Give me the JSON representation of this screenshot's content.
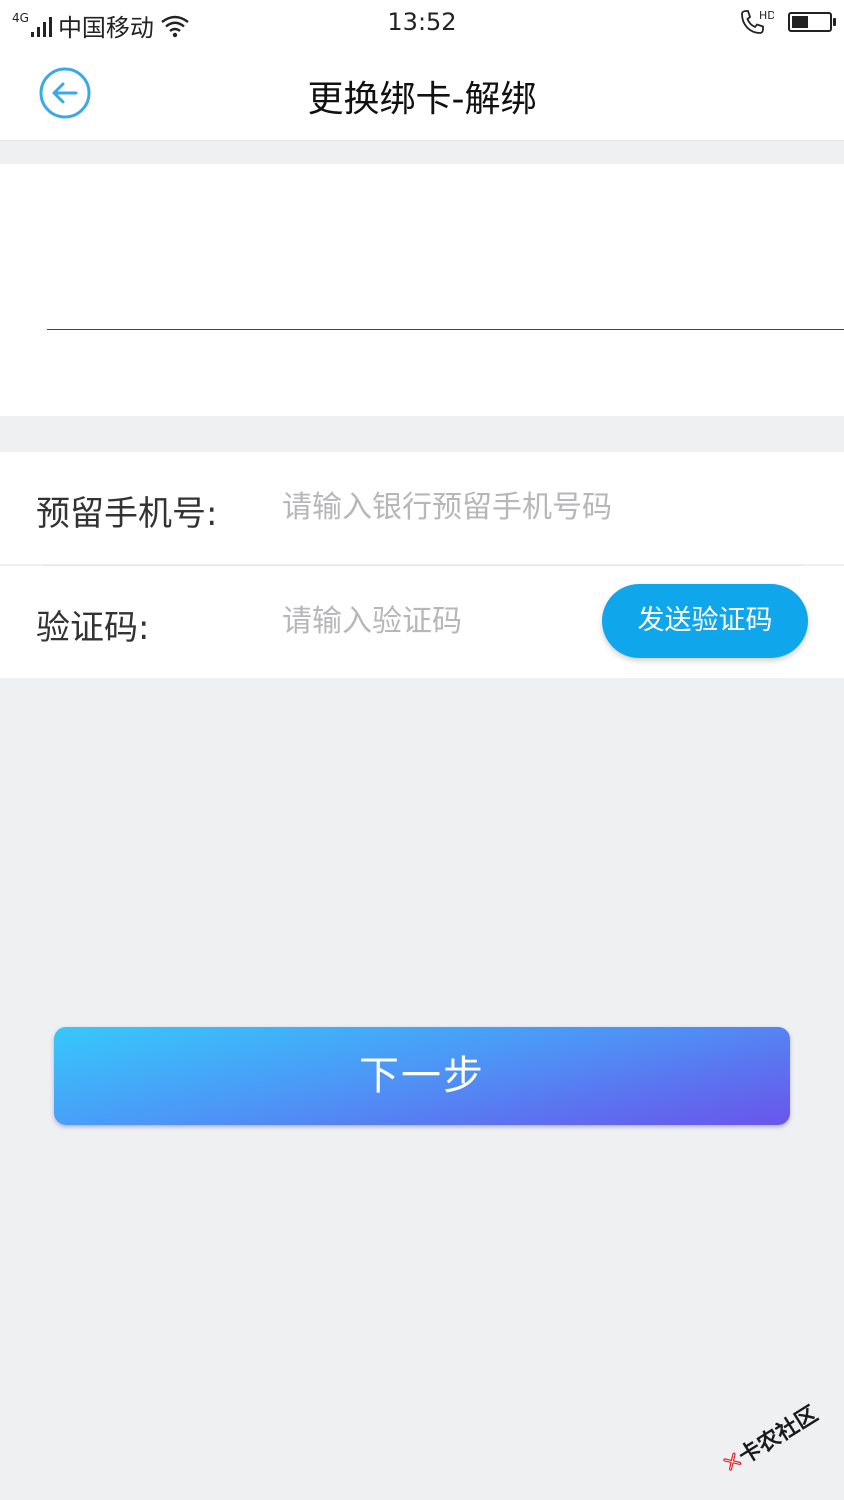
{
  "status_bar": {
    "network_type": "4G",
    "carrier": "中国移动",
    "time": "13:52",
    "battery_level": 0.45,
    "icons": [
      "signal-icon",
      "wifi-icon",
      "hd-call-icon",
      "battery-icon"
    ]
  },
  "header": {
    "title": "更换绑卡-解绑",
    "back_icon": "circle-arrow-left-icon",
    "accent_color": "#3aa9ec"
  },
  "form": {
    "phone": {
      "label": "预留手机号:",
      "placeholder": "请输入银行预留手机号码",
      "value": ""
    },
    "code": {
      "label": "验证码:",
      "placeholder": "请输入验证码",
      "value": "",
      "send_button_label": "发送验证码",
      "send_button_color": "#10a6ec"
    }
  },
  "actions": {
    "next_label": "下一步",
    "gradient_colors": [
      "#36c8fb",
      "#6a55eb"
    ]
  },
  "watermark": {
    "text": "卡农社区",
    "logo_icon": "kanong-logo-icon"
  }
}
